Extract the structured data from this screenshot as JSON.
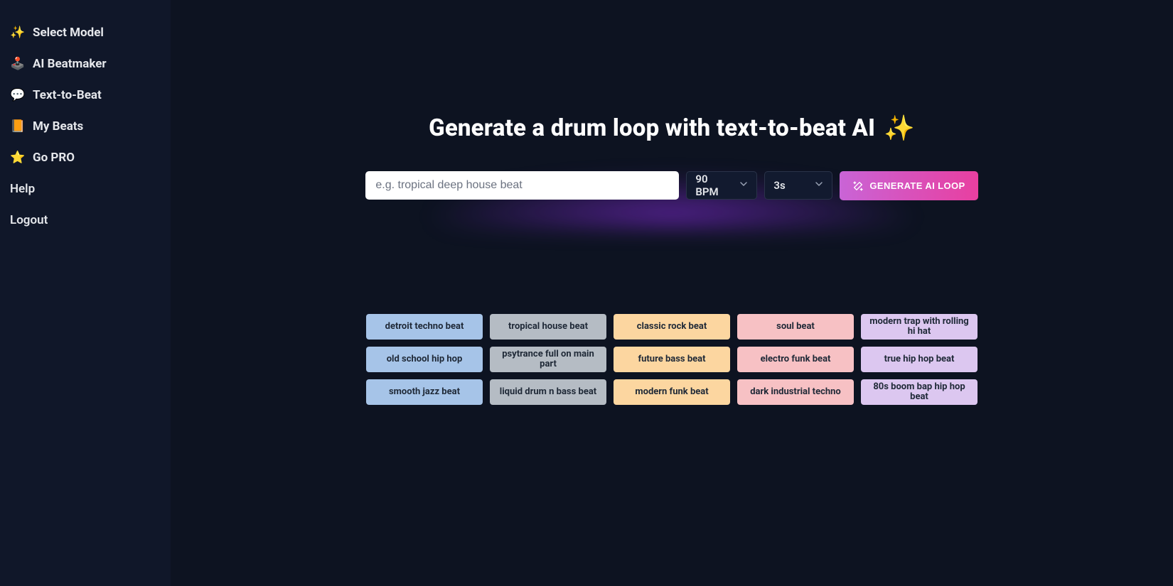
{
  "sidebar": {
    "items": [
      {
        "icon": "✨",
        "label": "Select Model"
      },
      {
        "icon": "🕹️",
        "label": "AI Beatmaker"
      },
      {
        "icon": "💬",
        "label": "Text-to-Beat"
      },
      {
        "icon": "📙",
        "label": "My Beats"
      },
      {
        "icon": "⭐",
        "label": "Go PRO"
      },
      {
        "icon": "",
        "label": "Help"
      },
      {
        "icon": "",
        "label": "Logout"
      }
    ]
  },
  "main": {
    "title": "Generate a drum loop with text-to-beat AI",
    "title_icon": "✨",
    "prompt_placeholder": "e.g. tropical deep house beat",
    "bpm_value": "90 BPM",
    "duration_value": "3s",
    "generate_label": "GENERATE AI LOOP"
  },
  "suggestions": [
    {
      "label": "detroit techno beat",
      "color": "blue"
    },
    {
      "label": "tropical house beat",
      "color": "gray"
    },
    {
      "label": "classic rock beat",
      "color": "orange"
    },
    {
      "label": "soul beat",
      "color": "pink"
    },
    {
      "label": "modern trap with rolling hi hat",
      "color": "purple"
    },
    {
      "label": "old school hip hop",
      "color": "blue"
    },
    {
      "label": "psytrance full on main part",
      "color": "gray"
    },
    {
      "label": "future bass beat",
      "color": "orange"
    },
    {
      "label": "electro funk beat",
      "color": "pink"
    },
    {
      "label": "true hip hop beat",
      "color": "purple"
    },
    {
      "label": "smooth jazz beat",
      "color": "blue"
    },
    {
      "label": "liquid drum n bass beat",
      "color": "gray"
    },
    {
      "label": "modern funk beat",
      "color": "orange"
    },
    {
      "label": "dark industrial techno",
      "color": "pink"
    },
    {
      "label": "80s boom bap hip hop beat",
      "color": "purple"
    }
  ]
}
